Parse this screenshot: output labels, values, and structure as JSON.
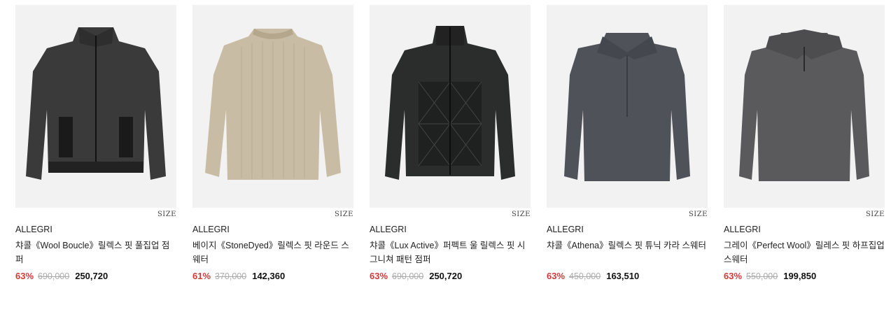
{
  "products": [
    {
      "brand": "ALLEGRI",
      "name": "챠콜《Wool Boucle》릴렉스 핏 풀집업 점퍼",
      "size_label": "SIZE",
      "discount": "63%",
      "original_price": "690,000",
      "sale_price": "250,720",
      "garment_color": "#3a3a3b",
      "icon": "zip-jacket-image"
    },
    {
      "brand": "ALLEGRI",
      "name": "베이지《StoneDyed》릴렉스 핏 라운드 스웨터",
      "size_label": "SIZE",
      "discount": "61%",
      "original_price": "370,000",
      "sale_price": "142,360",
      "garment_color": "#c9bca4",
      "icon": "crewneck-sweater-image"
    },
    {
      "brand": "ALLEGRI",
      "name": "챠콜《Lux Active》퍼펙트 울 릴렉스 핏 시그니쳐 패턴 점퍼",
      "size_label": "SIZE",
      "discount": "63%",
      "original_price": "690,000",
      "sale_price": "250,720",
      "garment_color": "#2b2c2c",
      "icon": "quilted-jacket-image"
    },
    {
      "brand": "ALLEGRI",
      "name": "챠콜《Athena》릴렉스 핏 튜닉 카라 스웨터",
      "size_label": "SIZE",
      "discount": "63%",
      "original_price": "450,000",
      "sale_price": "163,510",
      "garment_color": "#4f5259",
      "icon": "collar-sweater-image"
    },
    {
      "brand": "ALLEGRI",
      "name": "그레이《Perfect Wool》릴레스 핏 하프집업 스웨터",
      "size_label": "SIZE",
      "discount": "63%",
      "original_price": "550,000",
      "sale_price": "199,850",
      "garment_color": "#5a5a5c",
      "icon": "half-zip-sweater-image"
    }
  ],
  "colors": {
    "background": "#ffffff",
    "thumb_bg": "#f2f2f2",
    "discount": "#d23a3a",
    "muted": "#aaaaaa"
  }
}
